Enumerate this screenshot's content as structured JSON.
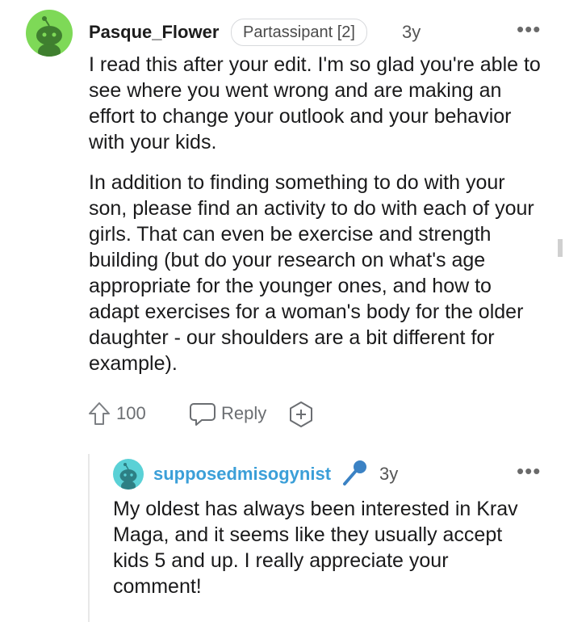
{
  "comment": {
    "author": "Pasque_Flower",
    "flair": "Partassipant [2]",
    "age": "3y",
    "more": "•••",
    "paragraphs": [
      "I read this after your edit. I'm so glad you're able to see where you went wrong and are making an effort to change your outlook and your behavior with your kids.",
      "In addition to finding something to do with your son, please find an activity to do with each of your girls. That can even be exercise and strength building (but do your research on what's age appropriate for the younger ones, and how to adapt exercises for a woman's body for the older daughter - our shoulders are a bit different for example)."
    ],
    "upvotes": "100",
    "reply_label": "Reply",
    "avatar_color": "#7ed957"
  },
  "reply": {
    "author": "supposedmisogynist",
    "age": "3y",
    "more": "•••",
    "body": "My oldest has always been interested in Krav Maga, and it seems like they usually accept kids 5 and up. I really appreciate your comment!",
    "avatar_color": "#5ad1d6",
    "username_color": "#3b9fd8"
  }
}
